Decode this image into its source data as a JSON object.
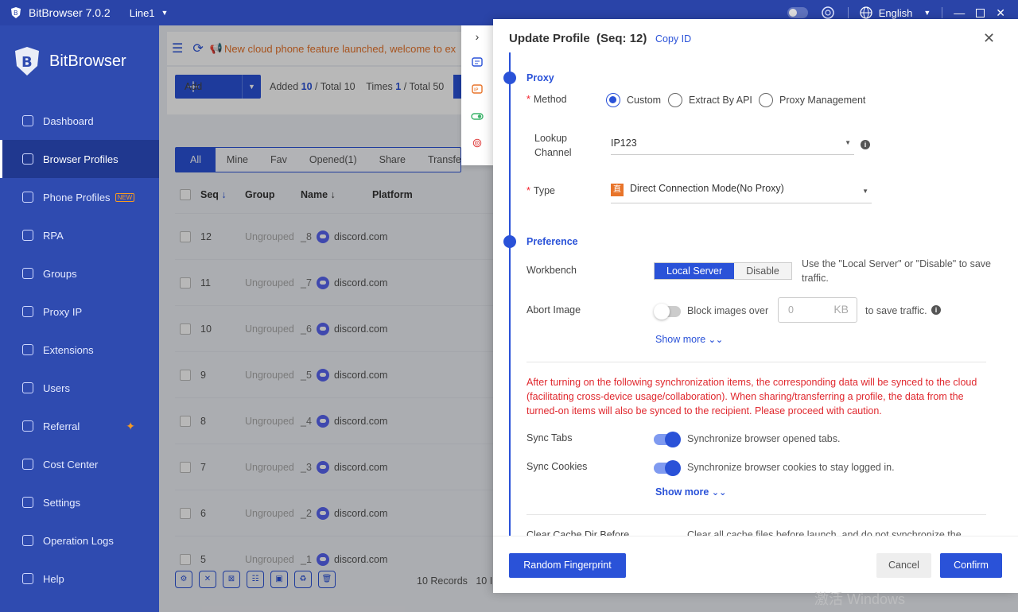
{
  "titlebar": {
    "app_name": "BitBrowser 7.0.2",
    "line": "Line1",
    "language": "English"
  },
  "sidebar": {
    "brand": "BitBrowser",
    "items": [
      {
        "label": "Dashboard",
        "icon": "home-icon"
      },
      {
        "label": "Browser Profiles",
        "icon": "grid-icon",
        "active": true
      },
      {
        "label": "Phone Profiles",
        "icon": "cloud-icon",
        "badge": "NEW"
      },
      {
        "label": "RPA",
        "icon": "rpa-icon"
      },
      {
        "label": "Groups",
        "icon": "layers-icon"
      },
      {
        "label": "Proxy IP",
        "icon": "location-icon"
      },
      {
        "label": "Extensions",
        "icon": "cube-icon"
      },
      {
        "label": "Users",
        "icon": "users-icon"
      },
      {
        "label": "Referral",
        "icon": "referral-icon"
      },
      {
        "label": "Cost Center",
        "icon": "shield-icon"
      },
      {
        "label": "Settings",
        "icon": "gear-icon"
      },
      {
        "label": "Operation Logs",
        "icon": "logs-icon"
      },
      {
        "label": "Help",
        "icon": "help-icon"
      }
    ]
  },
  "notice": {
    "text": "New cloud phone feature launched, welcome to ex"
  },
  "toolbar": {
    "add_label": "Add",
    "added_label": "Added",
    "added_value": "10",
    "total_label": "/ Total 10",
    "times_label": "Times",
    "times_value": "1",
    "total2_label": "/ Total 50"
  },
  "tabs": [
    "All",
    "Mine",
    "Fav",
    "Opened(1)",
    "Share",
    "Transfer"
  ],
  "table": {
    "headers": {
      "seq": "Seq",
      "group": "Group",
      "name": "Name",
      "platform": "Platform"
    },
    "rows": [
      {
        "seq": "12",
        "group": "Ungrouped",
        "name": "_8",
        "platform": "discord.com"
      },
      {
        "seq": "11",
        "group": "Ungrouped",
        "name": "_7",
        "platform": "discord.com"
      },
      {
        "seq": "10",
        "group": "Ungrouped",
        "name": "_6",
        "platform": "discord.com"
      },
      {
        "seq": "9",
        "group": "Ungrouped",
        "name": "_5",
        "platform": "discord.com"
      },
      {
        "seq": "8",
        "group": "Ungrouped",
        "name": "_4",
        "platform": "discord.com"
      },
      {
        "seq": "7",
        "group": "Ungrouped",
        "name": "_3",
        "platform": "discord.com"
      },
      {
        "seq": "6",
        "group": "Ungrouped",
        "name": "_2",
        "platform": "discord.com"
      },
      {
        "seq": "5",
        "group": "Ungrouped",
        "name": "_1",
        "platform": "discord.com"
      }
    ],
    "records": "10 Records",
    "records_tail": "10 I"
  },
  "drawer": {
    "title": "Update Profile",
    "seq": "(Seq: 12)",
    "copy_id": "Copy ID",
    "proxy": {
      "heading": "Proxy",
      "method_label": "Method",
      "methods": [
        "Custom",
        "Extract By API",
        "Proxy Management"
      ],
      "lookup_label_1": "Lookup",
      "lookup_label_2": "Channel",
      "lookup_value": "IP123",
      "type_label": "Type",
      "type_icon": "直",
      "type_value": "Direct Connection Mode(No Proxy)"
    },
    "preference": {
      "heading": "Preference",
      "workbench_label": "Workbench",
      "workbench_options": [
        "Local Server",
        "Disable"
      ],
      "workbench_note": "Use the \"Local Server\" or \"Disable\" to save traffic.",
      "abort_label": "Abort Image",
      "block_text": "Block images over",
      "kb_value": "0",
      "kb_unit": "KB",
      "save_traffic": "to save traffic.",
      "show_more": "Show more",
      "warning": "After turning on the following synchronization items, the corresponding data will be synced to the cloud (facilitating cross-device usage/collaboration). When sharing/transferring a profile, the data from the turned-on items will also be synced to the recipient. Please proceed with caution.",
      "sync_tabs_label": "Sync Tabs",
      "sync_tabs_note": "Synchronize browser opened tabs.",
      "sync_cookies_label": "Sync Cookies",
      "sync_cookies_note": "Synchronize browser cookies to stay logged in.",
      "show_more_2": "Show more",
      "clear_cache_label": "Clear Cache Dir Before",
      "clear_cache_note": "Clear all cache files before launch, and do not synchronize the"
    },
    "footer": {
      "random": "Random Fingerprint",
      "cancel": "Cancel",
      "confirm": "Confirm"
    }
  },
  "watermark": "激活 Windows"
}
